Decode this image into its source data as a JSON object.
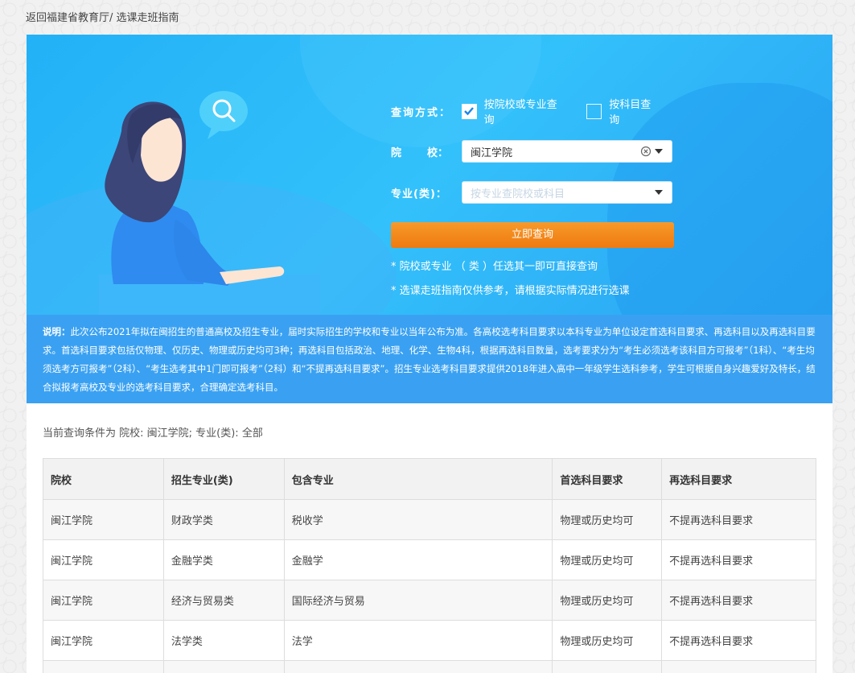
{
  "breadcrumb": {
    "back": "返回福建省教育厅",
    "sep": "/",
    "current": "选课走班指南"
  },
  "query": {
    "mode_label": "查询方式：",
    "options": [
      {
        "label": "按院校或专业查询",
        "checked": true
      },
      {
        "label": "按科目查询",
        "checked": false
      }
    ],
    "school_label": "院    校：",
    "school_value": "闽江学院",
    "major_label": "专业(类)：",
    "major_placeholder": "按专业查院校或科目",
    "submit": "立即查询",
    "notes": [
      "* 院校或专业 （ 类 ）任选其一即可直接查询",
      "* 选课走班指南仅供参考，请根据实际情况进行选课"
    ]
  },
  "description": {
    "title": "说明：",
    "text": "此次公布2021年拟在闽招生的普通高校及招生专业，届时实际招生的学校和专业以当年公布为准。各高校选考科目要求以本科专业为单位设定首选科目要求、再选科目以及再选科目要求。首选科目要求包括仅物理、仅历史、物理或历史均可3种；再选科目包括政治、地理、化学、生物4科，根据再选科目数量，选考要求分为“考生必须选考该科目方可报考”（1科）、“考生均须选考方可报考”（2科）、“考生选考其中1门即可报考”（2科）和“不提再选科目要求”。招生专业选考科目要求提供2018年进入高中一年级学生选科参考，学生可根据自身兴趣爱好及特长，结合拟报考高校及专业的选考科目要求，合理确定选考科目。"
  },
  "condition": "当前查询条件为   院校: 闽江学院; 专业(类): 全部",
  "table": {
    "headers": [
      "院校",
      "招生专业(类)",
      "包含专业",
      "首选科目要求",
      "再选科目要求"
    ],
    "rows": [
      [
        "闽江学院",
        "财政学类",
        "税收学",
        "物理或历史均可",
        "不提再选科目要求"
      ],
      [
        "闽江学院",
        "金融学类",
        "金融学",
        "物理或历史均可",
        "不提再选科目要求"
      ],
      [
        "闽江学院",
        "经济与贸易类",
        "国际经济与贸易",
        "物理或历史均可",
        "不提再选科目要求"
      ],
      [
        "闽江学院",
        "法学类",
        "法学",
        "物理或历史均可",
        "不提再选科目要求"
      ],
      [
        "",
        "",
        "",
        "",
        ""
      ]
    ]
  },
  "icons": {
    "checkbox": "check-icon",
    "clear": "clear-icon",
    "dropdown": "chevron-down-icon",
    "search": "search-icon"
  },
  "colors": {
    "banner": "#33c1fb",
    "button": "#f58a1f",
    "desc_bg": "#3aa1f2"
  }
}
